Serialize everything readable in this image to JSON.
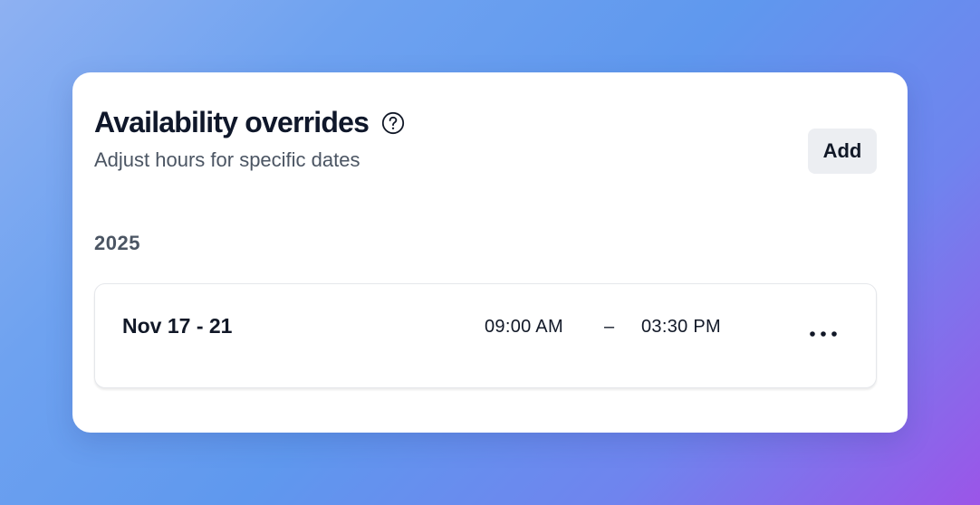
{
  "card": {
    "title": "Availability overrides",
    "subtitle": "Adjust hours for specific dates",
    "help_icon": "question-circle-icon",
    "add_label": "Add"
  },
  "overrides": {
    "year": "2025",
    "items": [
      {
        "date_range": "Nov 17 - 21",
        "start_time": "09:00 AM",
        "separator": "–",
        "end_time": "03:30 PM",
        "more_icon": "more-horizontal-icon"
      }
    ]
  },
  "colors": {
    "background_gradient": [
      "#8eb1f2",
      "#5f98ee",
      "#9b55e8"
    ],
    "card": "#ffffff",
    "button": "#eceef2",
    "text_primary": "#111827",
    "text_secondary": "#4b5563"
  }
}
